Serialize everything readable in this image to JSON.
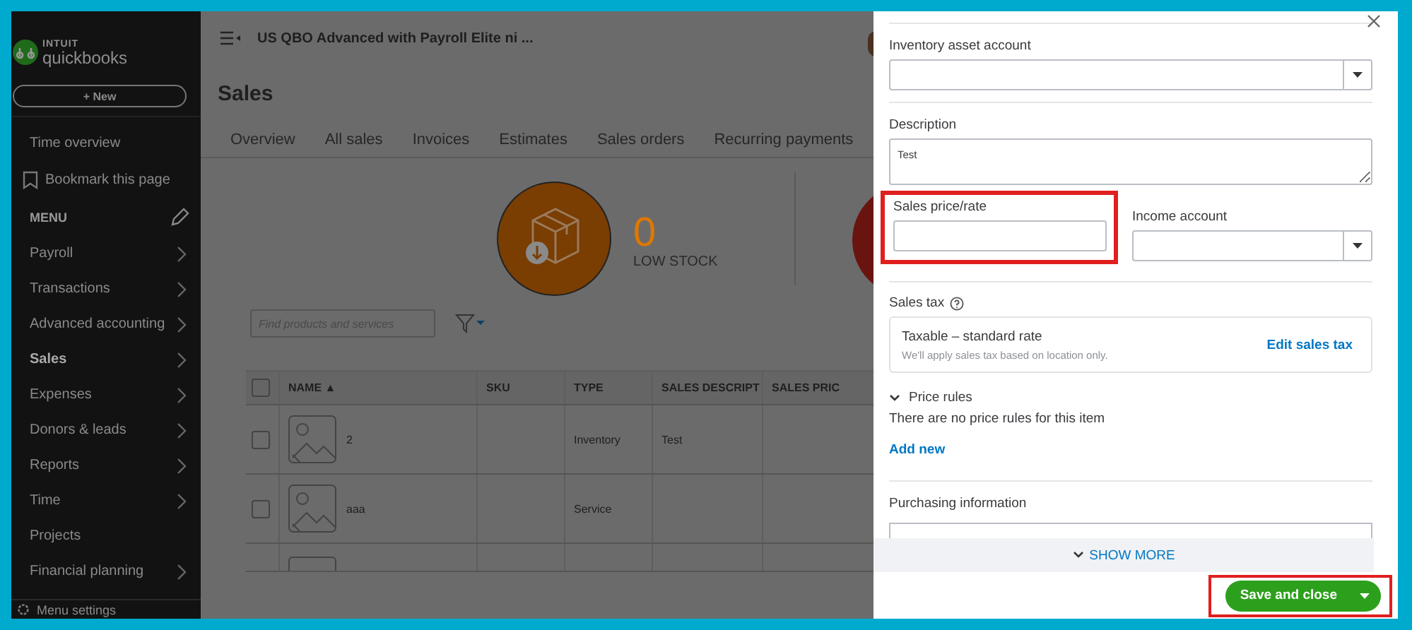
{
  "sidebar": {
    "logo_brand": "INTUIT",
    "logo_product": "quickbooks",
    "new_button": "+ New",
    "top_items": [
      "Time overview"
    ],
    "bookmark": "Bookmark this page",
    "menu_heading": "MENU",
    "items": [
      {
        "label": "Payroll",
        "has_submenu": true,
        "selected": false
      },
      {
        "label": "Transactions",
        "has_submenu": true,
        "selected": false
      },
      {
        "label": "Advanced accounting",
        "has_submenu": true,
        "selected": false
      },
      {
        "label": "Sales",
        "has_submenu": true,
        "selected": true
      },
      {
        "label": "Expenses",
        "has_submenu": true,
        "selected": false
      },
      {
        "label": "Donors & leads",
        "has_submenu": true,
        "selected": false
      },
      {
        "label": "Reports",
        "has_submenu": true,
        "selected": false
      },
      {
        "label": "Time",
        "has_submenu": true,
        "selected": false
      },
      {
        "label": "Projects",
        "has_submenu": false,
        "selected": false
      },
      {
        "label": "Financial planning",
        "has_submenu": true,
        "selected": false
      }
    ],
    "footer": "Menu settings"
  },
  "main": {
    "company": "US QBO Advanced with Payroll Elite ni ...",
    "page_title": "Sales",
    "tabs": [
      {
        "label": "Overview",
        "selected": false
      },
      {
        "label": "All sales",
        "selected": false
      },
      {
        "label": "Invoices",
        "selected": false
      },
      {
        "label": "Estimates",
        "selected": false
      },
      {
        "label": "Sales orders",
        "selected": false
      },
      {
        "label": "Recurring payments",
        "selected": false
      }
    ],
    "stock": {
      "count": "0",
      "label": "LOW STOCK"
    },
    "search": {
      "placeholder": "Find products and services"
    },
    "table": {
      "all_checked": false,
      "columns": [
        "NAME ▲",
        "SKU",
        "TYPE",
        "SALES DESCRIPT",
        "SALES PRIC"
      ],
      "rows": [
        {
          "checked": false,
          "name": "2",
          "type": "Inventory",
          "description": "Test"
        },
        {
          "checked": false,
          "name": "aaa",
          "type": "Service"
        }
      ]
    }
  },
  "panel": {
    "inventory_account": {
      "label": "Inventory asset account"
    },
    "description": {
      "label": "Description",
      "value": "Test"
    },
    "sales_price": {
      "label": "Sales price/rate",
      "highlighted": true
    },
    "income_account": {
      "label": "Income account"
    },
    "sales_tax": {
      "label": "Sales tax",
      "title": "Taxable – standard rate",
      "note": "We'll apply sales tax based on location only.",
      "link": "Edit sales tax"
    },
    "price_rules": {
      "label": "Price rules",
      "expanded": true,
      "empty_text": "There are no price rules for this item",
      "link": "Add new"
    },
    "purchasing": {
      "label": "Purchasing information"
    },
    "show_more": "SHOW MORE",
    "save_button": {
      "label": "Save and close",
      "highlighted": true
    }
  }
}
